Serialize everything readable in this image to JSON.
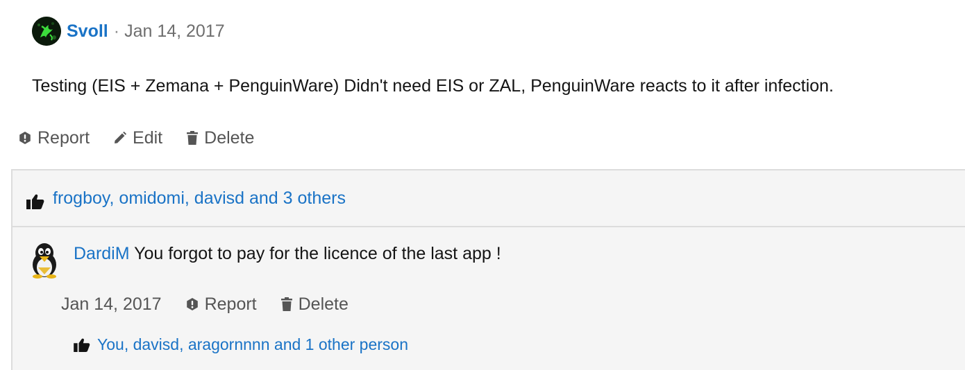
{
  "post": {
    "author": "Svoll",
    "separator": "·",
    "date": "Jan 14, 2017",
    "body": "Testing (EIS + Zemana + PenguinWare) Didn't need EIS or ZAL, PenguinWare reacts to it after infection.",
    "actions": {
      "report": "Report",
      "edit": "Edit",
      "delete": "Delete"
    },
    "reactions": "frogboy, omidomi, davisd and 3 others"
  },
  "comment": {
    "author": "DardiM",
    "text": "You forgot to pay for the licence of the last app !",
    "date": "Jan 14, 2017",
    "actions": {
      "report": "Report",
      "delete": "Delete"
    },
    "reactions": "You, davisd, aragornnnn and 1 other person"
  },
  "colors": {
    "link": "#1a73c6",
    "muted": "#555555",
    "panel_bg": "#f5f5f5",
    "border": "#dcdcdc"
  },
  "icons": {
    "report": "exclamation-circle-icon",
    "edit": "pencil-icon",
    "delete": "trash-icon",
    "like": "thumbs-up-icon"
  }
}
